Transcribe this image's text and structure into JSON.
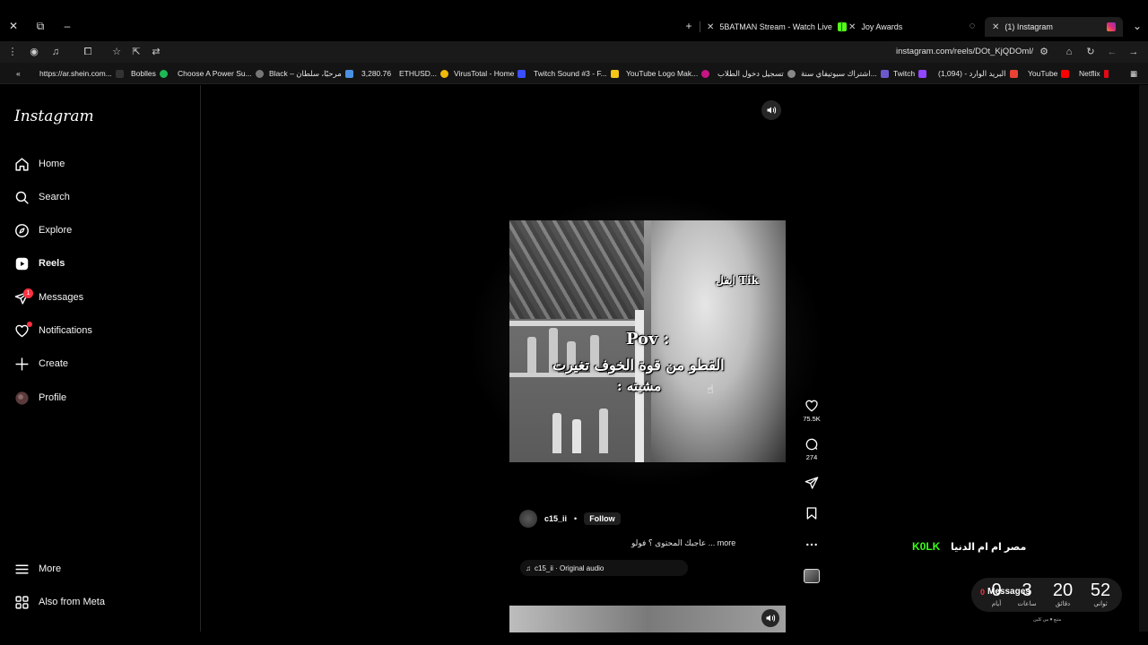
{
  "browser": {
    "tabs": [
      {
        "label": "5BATMAN Stream - Watch Live",
        "favicon_color": "#53fc18"
      },
      {
        "label": "Joy Awards",
        "favicon_color": "#444444"
      },
      {
        "label": "(1) Instagram",
        "favicon_color": "#e1306c"
      }
    ],
    "new_tab_label": "+",
    "url": "instagram.com/reels/DOt_KjQDOml/"
  },
  "bookmarks": [
    {
      "label": "https://ar.shein.com...",
      "icon": "S"
    },
    {
      "label": "Boblles",
      "icon": ""
    },
    {
      "label": "Choose A Power Su...",
      "icon": ""
    },
    {
      "label": "Black – مرحبًا، سلطان",
      "icon": ""
    },
    {
      "label": "3,280.76",
      "icon": ""
    },
    {
      "label": "ETHUSD...",
      "icon": ""
    },
    {
      "label": "VirusTotal - Home",
      "icon": ""
    },
    {
      "label": "Twitch Sound #3 - F...",
      "icon": ""
    },
    {
      "label": "YouTube Logo Mak...",
      "icon": ""
    },
    {
      "label": "تسجيل دخول الطلاب",
      "icon": ""
    },
    {
      "label": "اشتراك سبوتيفاي سنة...",
      "icon": ""
    },
    {
      "label": "Twitch",
      "icon": ""
    },
    {
      "label": "البريد الوارد - (1,094)",
      "icon": ""
    },
    {
      "label": "YouTube",
      "icon": ""
    },
    {
      "label": "Netflix",
      "icon": ""
    }
  ],
  "instagram": {
    "logo": "Instagram",
    "nav": [
      {
        "label": "Home"
      },
      {
        "label": "Search"
      },
      {
        "label": "Explore"
      },
      {
        "label": "Reels"
      },
      {
        "label": "Messages",
        "badge": "1"
      },
      {
        "label": "Notifications"
      },
      {
        "label": "Create"
      },
      {
        "label": "Profile"
      }
    ],
    "bottom_nav": [
      {
        "label": "More"
      },
      {
        "label": "Also from Meta"
      }
    ]
  },
  "reel": {
    "overlay_tag": "ايفل Tik",
    "overlay_line1": "Pov :",
    "overlay_line2": "القطو من قوة الخوف تغيرت",
    "overlay_line3": "مشيته :",
    "likes": "75.5K",
    "comments": "274",
    "username": "c15_ii",
    "separator": "•",
    "follow_label": "Follow",
    "caption": "عاجبك المحتوى ؟ فولو ... more",
    "audio": "c15_ii · Original audio"
  },
  "stream_widget": {
    "kolk": "K0LK",
    "egypt_text": "مصر ام ام الدنيا",
    "messages_label": "Messages",
    "messages_count": "0",
    "countdown": [
      {
        "value": "52",
        "unit": "ثواني"
      },
      {
        "value": "20",
        "unit": "دقائق"
      },
      {
        "value": "3",
        "unit": "ساعات"
      },
      {
        "value": "0",
        "unit": "أيام"
      }
    ],
    "credit": "متنع ♥ من كلين"
  },
  "colors": {
    "accent_green": "#39ff14",
    "notification_red": "#ff3040",
    "background": "#000000"
  }
}
